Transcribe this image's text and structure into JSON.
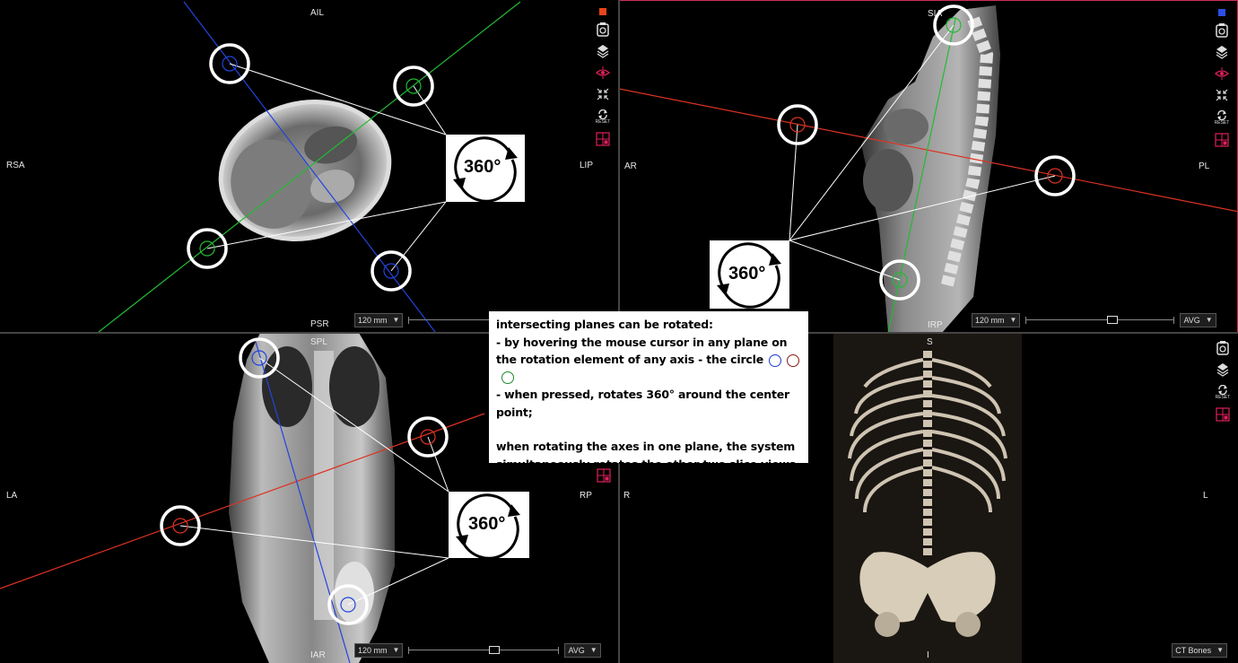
{
  "viewports": {
    "axial": {
      "labels": {
        "top": "AIL",
        "left": "RSA",
        "right": "LIP",
        "bottom": "PSR"
      },
      "thickness": "120 mm",
      "color": "#e8441a"
    },
    "sagittal": {
      "labels": {
        "top": "SIA",
        "left": "AR",
        "right": "PL",
        "bottom": "IRP"
      },
      "thickness": "120 mm",
      "mode": "AVG",
      "color": "#2b4fe8",
      "slider_position": 0.59
    },
    "coronal": {
      "labels": {
        "top": "SPL",
        "left": "LA",
        "right": "RP",
        "bottom": "IAR"
      },
      "thickness": "120 mm",
      "mode": "AVG",
      "slider_position": 0.58
    },
    "volume": {
      "labels": {
        "top": "S",
        "left": "R",
        "right": "L",
        "bottom": "I"
      },
      "preset": "CT Bones"
    }
  },
  "toolbar_icons": [
    "camera-icon",
    "layers-icon",
    "eye-icon",
    "collapse-icon",
    "reset-icon",
    "layout-icon"
  ],
  "toolbar": {
    "reset_label": "RESET"
  },
  "rotation_badge": "360°",
  "note": {
    "line1": "intersecting planes can be rotated:",
    "line2": "- by hovering the mouse cursor in any plane on the rotation element of any axis - the circle",
    "line3": "- when pressed, rotates 360° around the center point;",
    "line4": "when rotating the axes in one plane, the system simultaneously rotates the other two slice views",
    "ring_colors": [
      "#1a3bd4",
      "#8b1a0e",
      "#1b8a2a"
    ]
  },
  "colors": {
    "blue_axis": "#2244dd",
    "green_axis": "#22bb33",
    "red_axis": "#dd3322",
    "active_border": "#c8305a"
  }
}
